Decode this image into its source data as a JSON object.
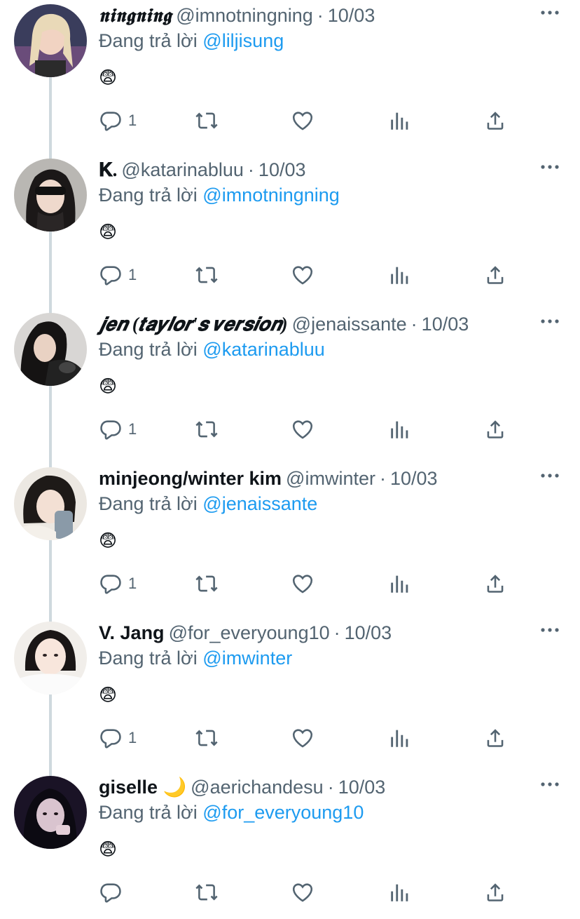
{
  "reply_prefix": "Đang trả lời",
  "icons": {
    "more": "more-horizontal-icon",
    "reply": "reply-icon",
    "retweet": "retweet-icon",
    "like": "heart-icon",
    "views": "views-icon",
    "share": "share-icon"
  },
  "colors": {
    "link": "#1d9bf0",
    "muted": "#536471",
    "text": "#0f1419",
    "thread": "#cfd9de"
  },
  "tweets": [
    {
      "name": "𝖓𝖎𝖓𝖌𝖓𝖎𝖓𝖌",
      "handle": "@imnotningning",
      "date": "10/03",
      "reply_to": "@liljisung",
      "text": "😨",
      "reply_count": "1"
    },
    {
      "name": "𝐊.",
      "handle": "@katarinabluu",
      "date": "10/03",
      "reply_to": "@imnotningning",
      "text": "😨",
      "reply_count": "1"
    },
    {
      "name": "𝒋𝒆𝒏 (𝒕𝒂𝒚𝒍𝒐𝒓'𝒔 𝒗𝒆𝒓𝒔𝒊𝒐𝒏)",
      "handle": "@jenaissante",
      "date": "10/03",
      "reply_to": "@katarinabluu",
      "text": "😨",
      "reply_count": "1"
    },
    {
      "name": "minjeong/winter kim",
      "handle": "@imwinter",
      "date": "10/03",
      "reply_to": "@jenaissante",
      "text": "😨",
      "reply_count": "1"
    },
    {
      "name": "V. Jang",
      "handle": "@for_everyoung10",
      "date": "10/03",
      "reply_to": "@imwinter",
      "text": "😨",
      "reply_count": "1"
    },
    {
      "name": "giselle 🌙",
      "handle": "@aerichandesu",
      "date": "10/03",
      "reply_to": "@for_everyoung10",
      "text": "😨",
      "reply_count": ""
    }
  ]
}
